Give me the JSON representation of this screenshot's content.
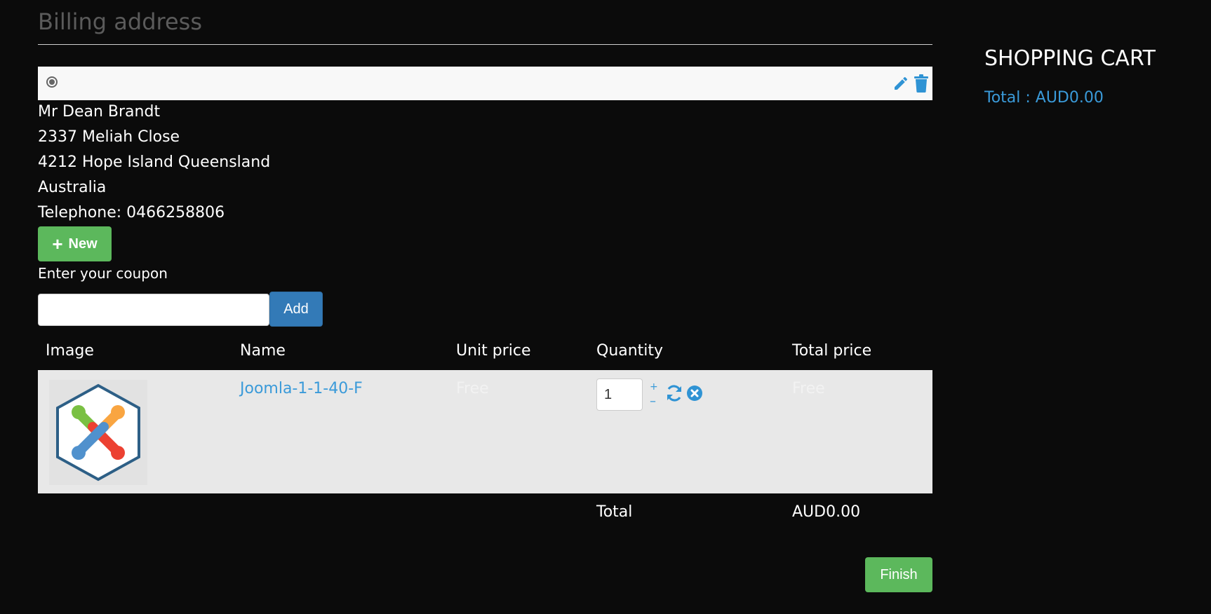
{
  "billing": {
    "title": "Billing address",
    "address": {
      "name": "Mr Dean Brandt",
      "street": "2337 Meliah Close",
      "city_line": "4212 Hope Island Queensland",
      "country": "Australia",
      "telephone": "Telephone: 0466258806"
    },
    "new_button_label": "New"
  },
  "coupon": {
    "label": "Enter your coupon",
    "input_value": "",
    "add_button_label": "Add"
  },
  "table": {
    "headers": [
      "Image",
      "Name",
      "Unit price",
      "Quantity",
      "Total price"
    ],
    "rows": [
      {
        "image_icon": "joomla-logo",
        "name": "Joomla-1-1-40-F",
        "unit_price": "Free",
        "quantity": "1",
        "qty_plus": "+",
        "qty_minus": "–",
        "total_price": "Free"
      }
    ],
    "total_label": "Total",
    "total_value": "AUD0.00"
  },
  "finish_button_label": "Finish",
  "sidebar": {
    "title": "SHOPPING CART",
    "total": "Total : AUD0.00"
  },
  "colors": {
    "background": "#0b0b0b",
    "link": "#3a9ad9",
    "success": "#5cb85c",
    "primary": "#337ab7",
    "row_bg": "#e8e8e8"
  }
}
